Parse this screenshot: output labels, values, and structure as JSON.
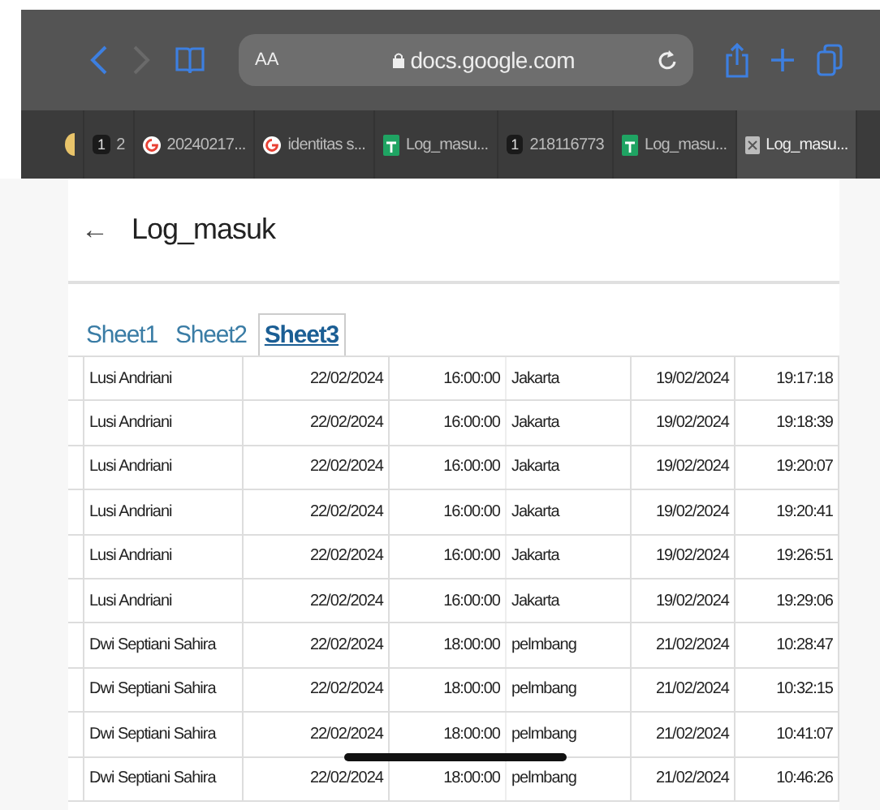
{
  "toolbar": {
    "text_size": "AA",
    "address": "docs.google.com"
  },
  "tabs": [
    {
      "kind": "cut",
      "selected": false
    },
    {
      "kind": "badge",
      "badge": "1",
      "label": "2",
      "selected": false
    },
    {
      "kind": "google",
      "label": "20240217...",
      "selected": false
    },
    {
      "kind": "google",
      "label": "identitas s...",
      "selected": false
    },
    {
      "kind": "sheets",
      "label": "Log_masu...",
      "selected": false
    },
    {
      "kind": "badge",
      "badge": "1",
      "label": "218116773",
      "selected": false
    },
    {
      "kind": "sheets",
      "label": "Log_masu...",
      "selected": false
    },
    {
      "kind": "doc",
      "label": "Log_masu...",
      "selected": true
    }
  ],
  "page": {
    "back": "←",
    "title": "Log_masuk"
  },
  "sheet_tabs": [
    {
      "label": "Sheet1",
      "selected": false
    },
    {
      "label": "Sheet2",
      "selected": false
    },
    {
      "label": "Sheet3",
      "selected": true
    }
  ],
  "table": {
    "rows": [
      [
        "Lusi Andriani",
        "22/02/2024",
        "16:00:00",
        "Jakarta",
        "19/02/2024",
        "19:17:18"
      ],
      [
        "Lusi Andriani",
        "22/02/2024",
        "16:00:00",
        "Jakarta",
        "19/02/2024",
        "19:18:39"
      ],
      [
        "Lusi Andriani",
        "22/02/2024",
        "16:00:00",
        "Jakarta",
        "19/02/2024",
        "19:20:07"
      ],
      [
        "Lusi Andriani",
        "22/02/2024",
        "16:00:00",
        "Jakarta",
        "19/02/2024",
        "19:20:41"
      ],
      [
        "Lusi Andriani",
        "22/02/2024",
        "16:00:00",
        "Jakarta",
        "19/02/2024",
        "19:26:51"
      ],
      [
        "Lusi Andriani",
        "22/02/2024",
        "16:00:00",
        "Jakarta",
        "19/02/2024",
        "19:29:06"
      ],
      [
        "Dwi Septiani Sahira",
        "22/02/2024",
        "18:00:00",
        "pelmbang",
        "21/02/2024",
        "10:28:47"
      ],
      [
        "Dwi Septiani Sahira",
        "22/02/2024",
        "18:00:00",
        "pelmbang",
        "21/02/2024",
        "10:32:15"
      ],
      [
        "Dwi Septiani Sahira",
        "22/02/2024",
        "18:00:00",
        "pelmbang",
        "21/02/2024",
        "10:41:07"
      ],
      [
        "Dwi Septiani Sahira",
        "22/02/2024",
        "18:00:00",
        "pelmbang",
        "21/02/2024",
        "10:46:26"
      ]
    ]
  }
}
